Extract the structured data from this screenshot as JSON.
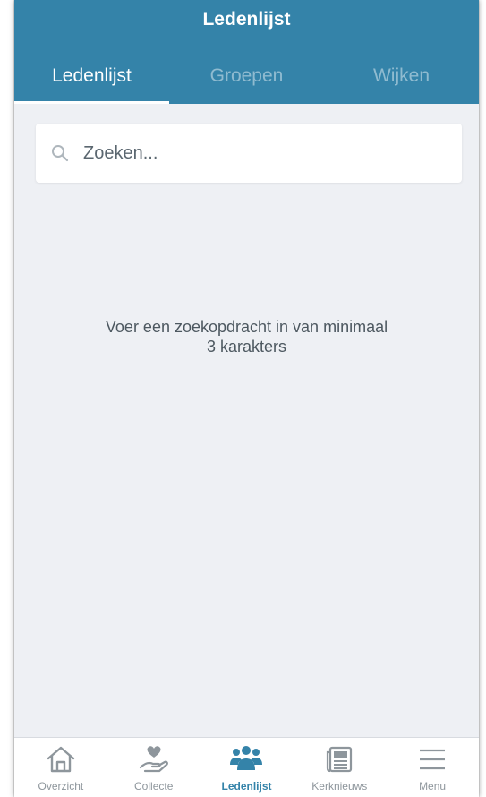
{
  "header": {
    "title": "Ledenlijst"
  },
  "tabs": [
    {
      "label": "Ledenlijst",
      "active": true
    },
    {
      "label": "Groepen",
      "active": false
    },
    {
      "label": "Wijken",
      "active": false
    }
  ],
  "search": {
    "placeholder": "Zoeken...",
    "value": "",
    "icon": "search-icon"
  },
  "empty_message": "Voer een zoekopdracht in van minimaal\n3 karakters",
  "bottom_nav": [
    {
      "label": "Overzicht",
      "icon": "home-icon",
      "active": false
    },
    {
      "label": "Collecte",
      "icon": "heart-hand-icon",
      "active": false
    },
    {
      "label": "Ledenlijst",
      "icon": "people-icon",
      "active": true
    },
    {
      "label": "Kerknieuws",
      "icon": "newspaper-icon",
      "active": false
    },
    {
      "label": "Menu",
      "icon": "menu-icon",
      "active": false
    }
  ],
  "colors": {
    "primary": "#3483a9",
    "background": "#eef0f4",
    "inactive_icon": "#8e969c"
  }
}
